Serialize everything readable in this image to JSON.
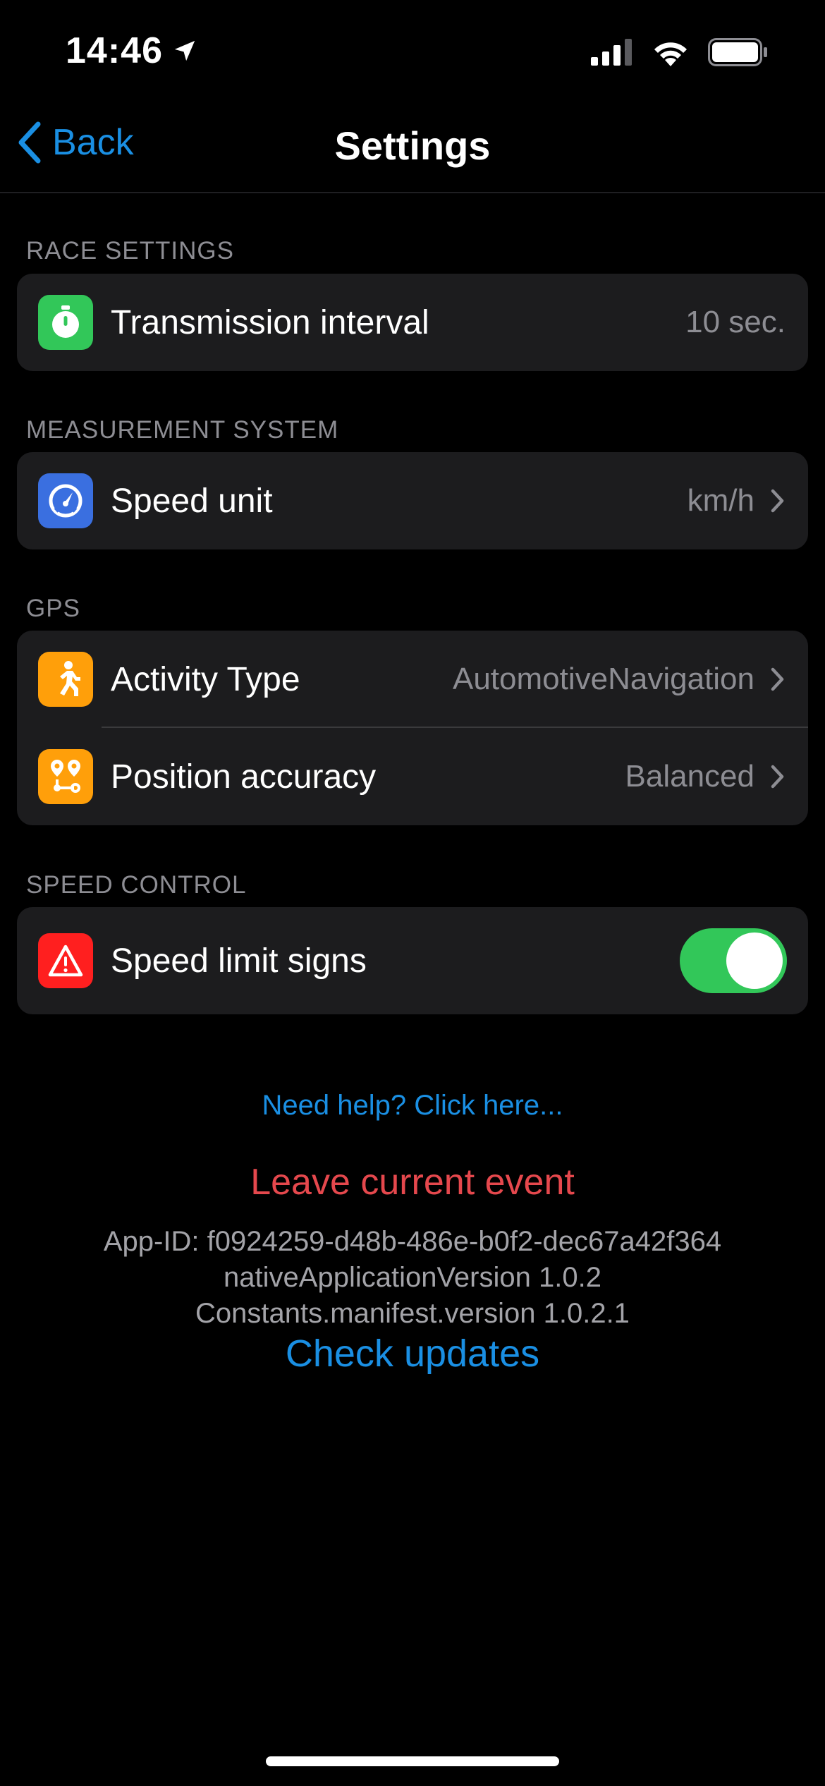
{
  "status_bar": {
    "time": "14:46"
  },
  "nav": {
    "back_label": "Back",
    "title": "Settings"
  },
  "sections": {
    "race": {
      "header": "RACE SETTINGS",
      "transmission": {
        "label": "Transmission interval",
        "value": "10 sec.",
        "icon": "stopwatch-icon",
        "icon_color": "#32c759"
      }
    },
    "measurement": {
      "header": "MEASUREMENT SYSTEM",
      "speed_unit": {
        "label": "Speed unit",
        "value": "km/h",
        "icon": "speedometer-icon",
        "icon_color": "#3a6fe0"
      }
    },
    "gps": {
      "header": "GPS",
      "activity_type": {
        "label": "Activity Type",
        "value": "AutomotiveNavigation",
        "icon": "running-person-icon",
        "icon_color": "#ff9f0a"
      },
      "position_accuracy": {
        "label": "Position accuracy",
        "value": "Balanced",
        "icon": "route-pins-icon",
        "icon_color": "#ff9f0a"
      }
    },
    "speed_control": {
      "header": "SPEED CONTROL",
      "speed_limit_signs": {
        "label": "Speed limit signs",
        "enabled": true,
        "icon": "warning-triangle-icon",
        "icon_color": "#ff3b30"
      }
    }
  },
  "footer": {
    "help_link": "Need help? Click here...",
    "leave_event": "Leave current event",
    "app_id": "App-ID: f0924259-d48b-486e-b0f2-dec67a42f364",
    "native_version": "nativeApplicationVersion 1.0.2",
    "manifest_version": "Constants.manifest.version 1.0.2.1",
    "check_updates": "Check updates"
  },
  "colors": {
    "accent": "#1a8fe3",
    "destructive": "#e5484d",
    "toggle_on": "#32c759"
  }
}
